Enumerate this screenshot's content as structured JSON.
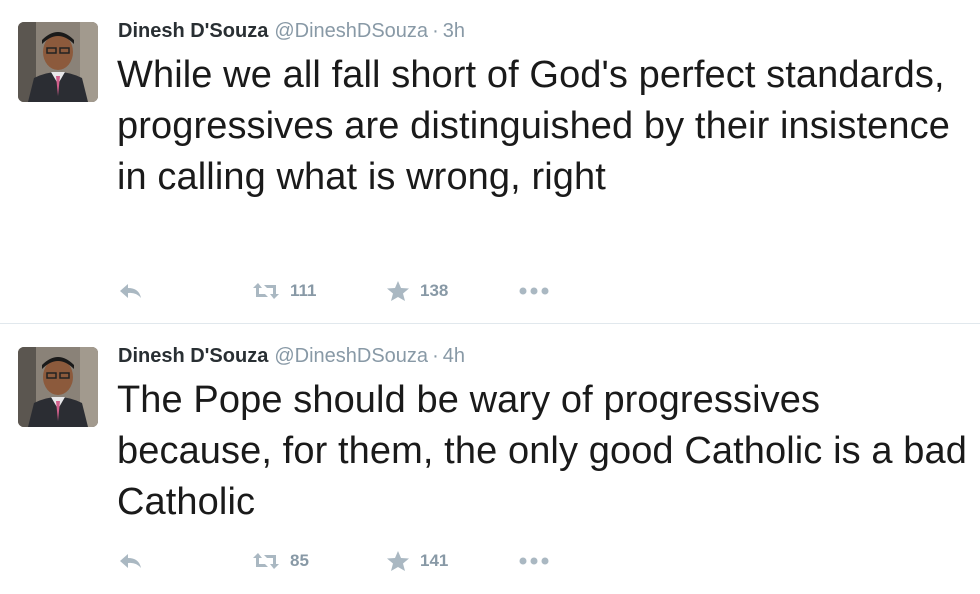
{
  "tweets": [
    {
      "fullname": "Dinesh D'Souza",
      "username": "@DineshDSouza",
      "separator": "·",
      "time": "3h",
      "text": "While we all fall short of God's perfect standards, progressives are distinguished by their insistence in calling what is wrong, right",
      "retweet_count": "111",
      "favorite_count": "138",
      "icons": [
        "reply-icon",
        "retweet-icon",
        "favorite-star-icon",
        "more-dots-icon"
      ]
    },
    {
      "fullname": "Dinesh D'Souza",
      "username": "@DineshDSouza",
      "separator": "·",
      "time": "4h",
      "text": "The Pope should be wary of progressives because, for them, the only good Catholic is a bad Catholic",
      "retweet_count": "85",
      "favorite_count": "141",
      "icons": [
        "reply-icon",
        "retweet-icon",
        "favorite-star-icon",
        "more-dots-icon"
      ]
    }
  ],
  "colors": {
    "name": "#292f33",
    "meta": "#8899a6",
    "icon": "#aab8c2",
    "divider": "#e1e8ed"
  }
}
